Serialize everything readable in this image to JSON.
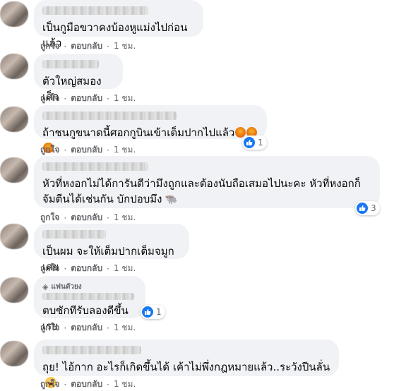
{
  "comments": [
    {
      "badge": "",
      "text": "เป็นกูมือขวาคงบ้องหูแม่งไปก่อนแล้ว",
      "emoji": "",
      "likes": "",
      "actions": {
        "like": "ถูกใจ",
        "reply": "ตอบกลับ",
        "time": "1 ชม."
      }
    },
    {
      "badge": "",
      "text": "ตัวใหญ่สมองเล็ก",
      "emoji": "",
      "likes": "",
      "actions": {
        "like": "ถูกใจ",
        "reply": "ตอบกลับ",
        "time": "1 ชม."
      }
    },
    {
      "badge": "",
      "text": "ถ้าชนกูขนาดนี้ศอกกูบินเข้าเต็มปากไปแล้ว",
      "emoji": "angry-face x3",
      "likes": "1",
      "actions": {
        "like": "ถูกใจ",
        "reply": "ตอบกลับ",
        "time": "1 ชม."
      }
    },
    {
      "badge": "",
      "text": "หัวที่หงอกไม่ได้การันตีว่ามึงถูกและต้องนับถือเสมอไปนะคะ หัวที่หงอกก็จัมตีนได้เช่นกัน บักปอบมึง",
      "emoji": "bull",
      "likes": "3",
      "actions": {
        "like": "ถูกใจ",
        "reply": "ตอบกลับ",
        "time": "1 ชม."
      }
    },
    {
      "badge": "",
      "text": "เป็นผม จะให้เต็มปากเต็มจมูกเลย",
      "emoji": "",
      "likes": "",
      "actions": {
        "like": "ถูกใจ",
        "reply": "ตอบกลับ",
        "time": "1 ชม."
      }
    },
    {
      "badge": "แฟนตัวยง",
      "text": "ตบซักทีรับลองดีขึ้นเรย",
      "emoji": "",
      "likes": "1",
      "actions": {
        "like": "ถูกใจ",
        "reply": "ตอบกลับ",
        "time": "1 ชม."
      }
    },
    {
      "badge": "",
      "text": "ถุย! ไอ้กาก อะไรก็เกิดขึ้นได้ เค้าไม่พึ่งกฎหมายแล้ว..ระวังปีนลั่น",
      "emoji": "laughing",
      "likes": "",
      "actions": {
        "like": "ถูกใจ",
        "reply": "ตอบกลับ",
        "time": "1 ชม."
      }
    }
  ]
}
